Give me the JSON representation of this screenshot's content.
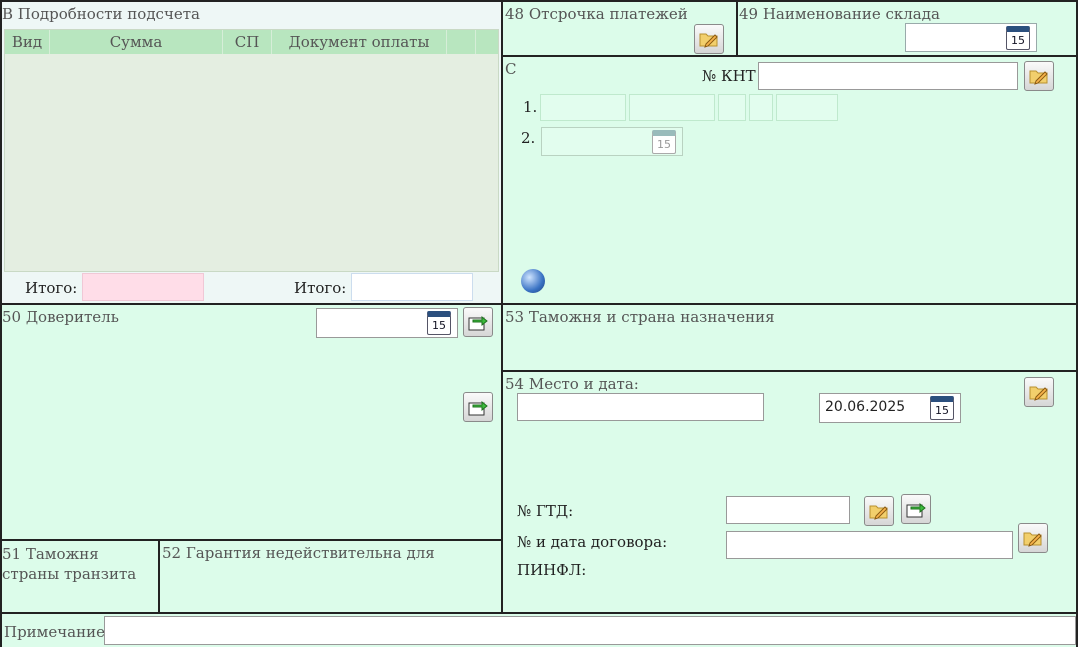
{
  "section_b": {
    "title": "В Подробности подсчета",
    "columns": [
      "Вид",
      "Сумма",
      "СП",
      "Документ оплаты"
    ],
    "total_label_1": "Итого:",
    "total_label_2": "Итого:"
  },
  "section_48": {
    "title": "48 Отсрочка платежей"
  },
  "section_49": {
    "title": "49 Наименование склада",
    "value": ""
  },
  "section_c": {
    "title": "C",
    "knt_label": "№ КНТ",
    "knt_value": "",
    "row1_label": "1.",
    "row2_label": "2."
  },
  "section_50": {
    "title": "50 Доверитель",
    "date_value": ""
  },
  "section_53": {
    "title": "53 Таможня и страна назначения"
  },
  "section_54": {
    "title": "54 Место и дата:",
    "place_value": "",
    "date_value": "20.06.2025",
    "gtd_label": "№ ГТД:",
    "gtd_value": "",
    "contract_label": "№ и дата договора:",
    "contract_value": "",
    "pinfl_label": "ПИНФЛ:"
  },
  "section_51": {
    "title": "51 Таможня страны транзита"
  },
  "section_52": {
    "title": "52 Гарантия недействительна для"
  },
  "note": {
    "label": "Примечание",
    "value": ""
  },
  "icons": {
    "calendar_day": "15",
    "edit": "pencil-folder-icon",
    "export": "arrow-export-icon",
    "globe": "globe-icon"
  },
  "colors": {
    "cell_bg": "#dcfcea",
    "table_header": "#b8e6bf",
    "table_body": "#e4eee1",
    "pink_total": "#ffdde8"
  }
}
